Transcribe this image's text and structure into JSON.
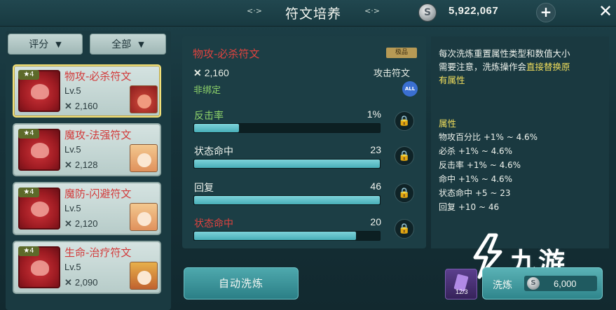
{
  "header": {
    "title": "符文培养",
    "currency_value": "5,922,067",
    "currency_icon": "silver-coin-icon",
    "plus_label": "+",
    "close_label": "✕"
  },
  "filters": {
    "sort_label": "评分",
    "category_label": "全部"
  },
  "rune_list": [
    {
      "stars": "★4",
      "name": "物攻-必杀符文",
      "level": "Lv.5",
      "score": "2,160",
      "selected": true
    },
    {
      "stars": "★4",
      "name": "魔攻-法强符文",
      "level": "Lv.5",
      "score": "2,128",
      "selected": false
    },
    {
      "stars": "★4",
      "name": "魔防-闪避符文",
      "level": "Lv.5",
      "score": "2,120",
      "selected": false
    },
    {
      "stars": "★4",
      "name": "生命-治疗符文",
      "level": "Lv.5",
      "score": "2,090",
      "selected": false
    }
  ],
  "detail": {
    "name": "物攻-必杀符文",
    "tag": "极品",
    "score": "2,160",
    "type": "攻击符文",
    "bind_status": "非绑定",
    "all_badge": "ALL",
    "attributes": [
      {
        "label": "反击率",
        "value": "1%",
        "fill": 0.24,
        "label_color": "#8fd46a"
      },
      {
        "label": "状态命中",
        "value": "23",
        "fill": 1.0,
        "label_color": "#eef2ec"
      },
      {
        "label": "回复",
        "value": "46",
        "fill": 1.0,
        "label_color": "#eef2ec"
      },
      {
        "label": "状态命中",
        "value": "20",
        "fill": 0.87,
        "label_color": "#e0433f"
      }
    ]
  },
  "info": {
    "line1": "每次洗炼重置属性类型和数值大小",
    "line2a": "需要注意，洗炼操作会",
    "line2b": "直接替换原有属性",
    "attr_head": "属性",
    "ranges": [
      "物攻百分比 +1% ~ 4.6%",
      "必杀 +1% ~ 4.6%",
      "反击率 +1% ~ 4.6%",
      "命中 +1% ~ 4.6%",
      "状态命中 +5 ~ 23",
      "回复 +10 ~ 46"
    ]
  },
  "bottom": {
    "auto_wash_label": "自动洗炼",
    "material_count": "12/3",
    "wash_label": "洗炼",
    "wash_cost": "6,000"
  },
  "watermark": {
    "text": "九游"
  },
  "colors": {
    "accent_red": "#e0433f",
    "accent_green": "#8fd46a",
    "accent_yellow": "#f3df5c",
    "bar_fill": "#48aeb8"
  }
}
